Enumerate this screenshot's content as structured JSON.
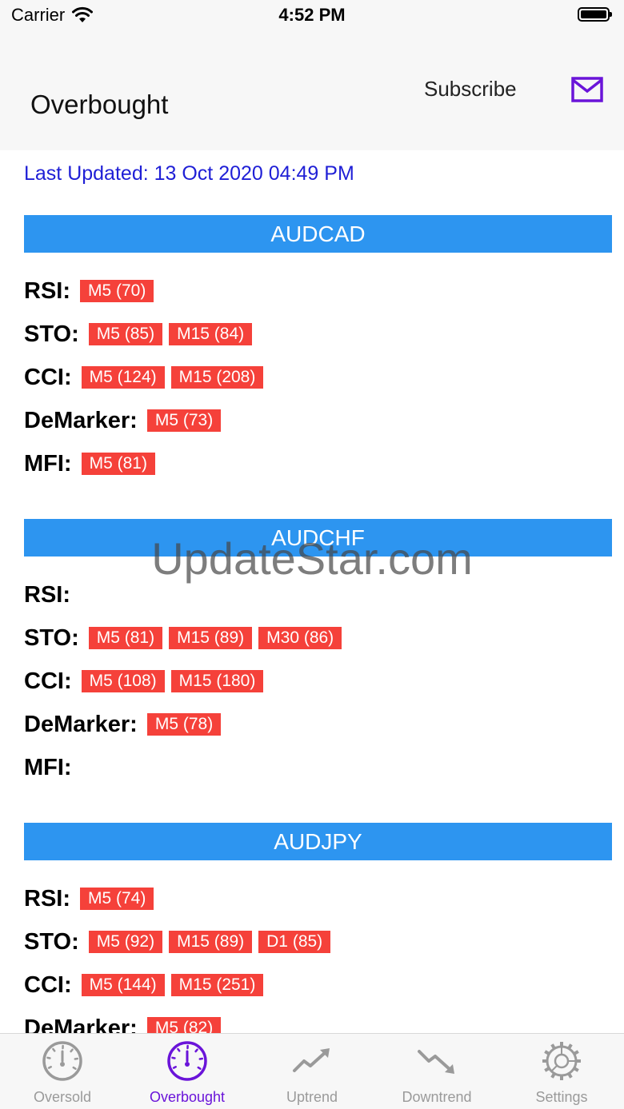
{
  "status": {
    "carrier": "Carrier",
    "time": "4:52 PM"
  },
  "nav": {
    "title": "Overbought",
    "subscribe": "Subscribe"
  },
  "last_updated": "Last Updated: 13 Oct 2020 04:49 PM",
  "watermark": "UpdateStar.com",
  "pairs": [
    {
      "name": "AUDCAD",
      "rows": [
        {
          "label": "RSI:",
          "tags": [
            "M5 (70)"
          ]
        },
        {
          "label": "STO:",
          "tags": [
            "M5 (85)",
            "M15 (84)"
          ]
        },
        {
          "label": "CCI:",
          "tags": [
            "M5 (124)",
            "M15 (208)"
          ]
        },
        {
          "label": "DeMarker:",
          "tags": [
            "M5 (73)"
          ]
        },
        {
          "label": "MFI:",
          "tags": [
            "M5 (81)"
          ]
        }
      ]
    },
    {
      "name": "AUDCHF",
      "rows": [
        {
          "label": "RSI:",
          "tags": []
        },
        {
          "label": "STO:",
          "tags": [
            "M5 (81)",
            "M15 (89)",
            "M30 (86)"
          ]
        },
        {
          "label": "CCI:",
          "tags": [
            "M5 (108)",
            "M15 (180)"
          ]
        },
        {
          "label": "DeMarker:",
          "tags": [
            "M5 (78)"
          ]
        },
        {
          "label": "MFI:",
          "tags": []
        }
      ]
    },
    {
      "name": "AUDJPY",
      "rows": [
        {
          "label": "RSI:",
          "tags": [
            "M5 (74)"
          ]
        },
        {
          "label": "STO:",
          "tags": [
            "M5 (92)",
            "M15 (89)",
            "D1 (85)"
          ]
        },
        {
          "label": "CCI:",
          "tags": [
            "M5 (144)",
            "M15 (251)"
          ]
        },
        {
          "label": "DeMarker:",
          "tags": [
            "M5 (82)"
          ]
        }
      ]
    }
  ],
  "tabs": [
    {
      "label": "Oversold",
      "icon": "gauge-low-icon",
      "active": false
    },
    {
      "label": "Overbought",
      "icon": "gauge-high-icon",
      "active": true
    },
    {
      "label": "Uptrend",
      "icon": "trend-up-icon",
      "active": false
    },
    {
      "label": "Downtrend",
      "icon": "trend-down-icon",
      "active": false
    },
    {
      "label": "Settings",
      "icon": "gear-icon",
      "active": false
    }
  ],
  "colors": {
    "accent": "#6a14d9",
    "header_blue": "#2d95f0",
    "tag_red": "#f5413a",
    "link_blue": "#1f1fd6"
  }
}
